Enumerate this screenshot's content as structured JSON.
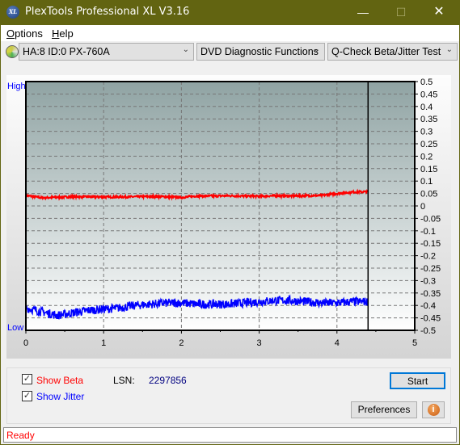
{
  "window": {
    "title": "PlexTools Professional XL V3.16",
    "logo_text": "XL"
  },
  "menu": [
    {
      "label": "Options",
      "u": "O",
      "rest": "ptions"
    },
    {
      "label": "Help",
      "u": "H",
      "rest": "elp"
    }
  ],
  "toolbar": {
    "drive": "HA:8 ID:0  PX-760A",
    "function": "DVD Diagnostic Functions",
    "test": "Q-Check Beta/Jitter Test"
  },
  "chart_data": {
    "type": "line",
    "xlim": [
      0,
      5
    ],
    "ylim": [
      -0.5,
      0.5
    ],
    "x_ticks": [
      "0",
      "1",
      "2",
      "3",
      "4",
      "5"
    ],
    "y_ticks": [
      "0.5",
      "0.45",
      "0.4",
      "0.35",
      "0.3",
      "0.25",
      "0.2",
      "0.15",
      "0.1",
      "0.05",
      "0",
      "-0.05",
      "-0.1",
      "-0.15",
      "-0.2",
      "-0.25",
      "-0.3",
      "-0.35",
      "-0.4",
      "-0.45",
      "-0.5"
    ],
    "left_labels": {
      "top": "High",
      "bottom": "Low"
    },
    "grid": true,
    "cursor_x": 4.4,
    "x": [
      0,
      0.2,
      0.4,
      0.6,
      0.8,
      1.0,
      1.2,
      1.4,
      1.6,
      1.8,
      2.0,
      2.2,
      2.4,
      2.6,
      2.8,
      3.0,
      3.2,
      3.4,
      3.6,
      3.8,
      4.0,
      4.2,
      4.4
    ],
    "series": [
      {
        "color": "#ff0000",
        "values": [
          0.042,
          0.033,
          0.035,
          0.037,
          0.037,
          0.036,
          0.036,
          0.037,
          0.038,
          0.037,
          0.034,
          0.04,
          0.04,
          0.041,
          0.04,
          0.039,
          0.041,
          0.04,
          0.041,
          0.042,
          0.05,
          0.056,
          0.057
        ]
      },
      {
        "color": "#0000ff",
        "values": [
          -0.41,
          -0.425,
          -0.44,
          -0.43,
          -0.42,
          -0.415,
          -0.41,
          -0.4,
          -0.395,
          -0.39,
          -0.39,
          -0.395,
          -0.395,
          -0.395,
          -0.39,
          -0.385,
          -0.38,
          -0.38,
          -0.385,
          -0.39,
          -0.39,
          -0.385,
          -0.385
        ]
      }
    ]
  },
  "controls": {
    "show_beta": "Show Beta",
    "show_jitter": "Show Jitter",
    "lsn_label": "LSN:",
    "lsn_value": "2297856",
    "start": "Start",
    "preferences": "Preferences",
    "beta_checked": true,
    "jitter_checked": true
  },
  "status": "Ready"
}
